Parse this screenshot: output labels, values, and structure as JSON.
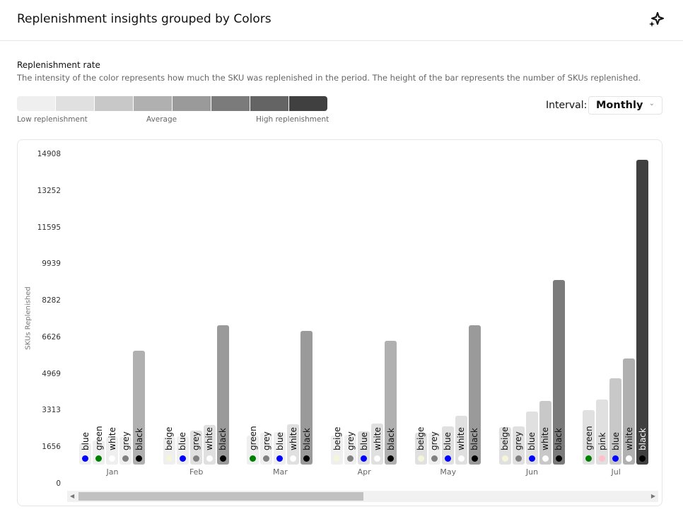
{
  "header": {
    "title": "Replenishment insights grouped by Colors",
    "icon": "sparkle-icon"
  },
  "rate": {
    "title": "Replenishment rate",
    "description": "The intensity of the color represents how much the SKU was replenished in the period. The height of the bar represents the number of SKUs replenished.",
    "scale_colors": [
      "#efefef",
      "#e0e0e0",
      "#c8c8c8",
      "#b0b0b0",
      "#9a9a9a",
      "#7b7b7b",
      "#646464",
      "#404040"
    ],
    "low": "Low replenishment",
    "avg": "Average",
    "high": "High replenishment"
  },
  "interval": {
    "label": "Interval:",
    "value": "Monthly"
  },
  "chart_data": {
    "type": "bar",
    "ylabel": "SKUs Replenished",
    "ylim": [
      0,
      14908
    ],
    "yticks": [
      "0",
      "1656",
      "3313",
      "4969",
      "6626",
      "8282",
      "9939",
      "11595",
      "13252",
      "14908"
    ],
    "dot_colors": {
      "blue": "#0000ff",
      "green": "#008000",
      "white": "#ffffff",
      "grey": "#808080",
      "black": "#000000",
      "beige": "#f5f5dc",
      "pink": "#ffc0cb"
    },
    "groups": [
      {
        "month": "Jan",
        "bars": [
          {
            "sku": "blue",
            "value": 1856,
            "intensity": 0
          },
          {
            "sku": "green",
            "value": 1984,
            "intensity": 0
          },
          {
            "sku": "white",
            "value": 2144,
            "intensity": 0
          },
          {
            "sku": "grey",
            "value": 2144,
            "intensity": 0
          },
          {
            "sku": "black",
            "value": 6048,
            "intensity": 3
          }
        ]
      },
      {
        "month": "Feb",
        "bars": [
          {
            "sku": "beige",
            "value": 2144,
            "intensity": 0
          },
          {
            "sku": "blue",
            "value": 2176,
            "intensity": 0
          },
          {
            "sku": "grey",
            "value": 2432,
            "intensity": 1
          },
          {
            "sku": "white",
            "value": 2688,
            "intensity": 1
          },
          {
            "sku": "black",
            "value": 7200,
            "intensity": 4
          }
        ]
      },
      {
        "month": "Mar",
        "bars": [
          {
            "sku": "green",
            "value": 2208,
            "intensity": 0
          },
          {
            "sku": "grey",
            "value": 2336,
            "intensity": 0
          },
          {
            "sku": "blue",
            "value": 2368,
            "intensity": 0
          },
          {
            "sku": "white",
            "value": 2720,
            "intensity": 1
          },
          {
            "sku": "black",
            "value": 6944,
            "intensity": 4
          }
        ]
      },
      {
        "month": "Apr",
        "bars": [
          {
            "sku": "beige",
            "value": 2208,
            "intensity": 0
          },
          {
            "sku": "grey",
            "value": 2240,
            "intensity": 0
          },
          {
            "sku": "blue",
            "value": 2400,
            "intensity": 1
          },
          {
            "sku": "white",
            "value": 2752,
            "intensity": 1
          },
          {
            "sku": "black",
            "value": 6496,
            "intensity": 3
          }
        ]
      },
      {
        "month": "May",
        "bars": [
          {
            "sku": "beige",
            "value": 2336,
            "intensity": 1
          },
          {
            "sku": "grey",
            "value": 2336,
            "intensity": 0
          },
          {
            "sku": "blue",
            "value": 2624,
            "intensity": 1
          },
          {
            "sku": "white",
            "value": 3104,
            "intensity": 1
          },
          {
            "sku": "black",
            "value": 7200,
            "intensity": 4
          }
        ]
      },
      {
        "month": "Jun",
        "bars": [
          {
            "sku": "beige",
            "value": 2592,
            "intensity": 1
          },
          {
            "sku": "grey",
            "value": 2624,
            "intensity": 1
          },
          {
            "sku": "blue",
            "value": 3296,
            "intensity": 1
          },
          {
            "sku": "white",
            "value": 3776,
            "intensity": 2
          },
          {
            "sku": "black",
            "value": 9248,
            "intensity": 5
          }
        ]
      },
      {
        "month": "Jul",
        "bars": [
          {
            "sku": "green",
            "value": 3360,
            "intensity": 1
          },
          {
            "sku": "pink",
            "value": 3840,
            "intensity": 1
          },
          {
            "sku": "blue",
            "value": 4800,
            "intensity": 2
          },
          {
            "sku": "white",
            "value": 5696,
            "intensity": 3
          },
          {
            "sku": "black",
            "value": 14688,
            "intensity": 7
          }
        ]
      }
    ]
  }
}
